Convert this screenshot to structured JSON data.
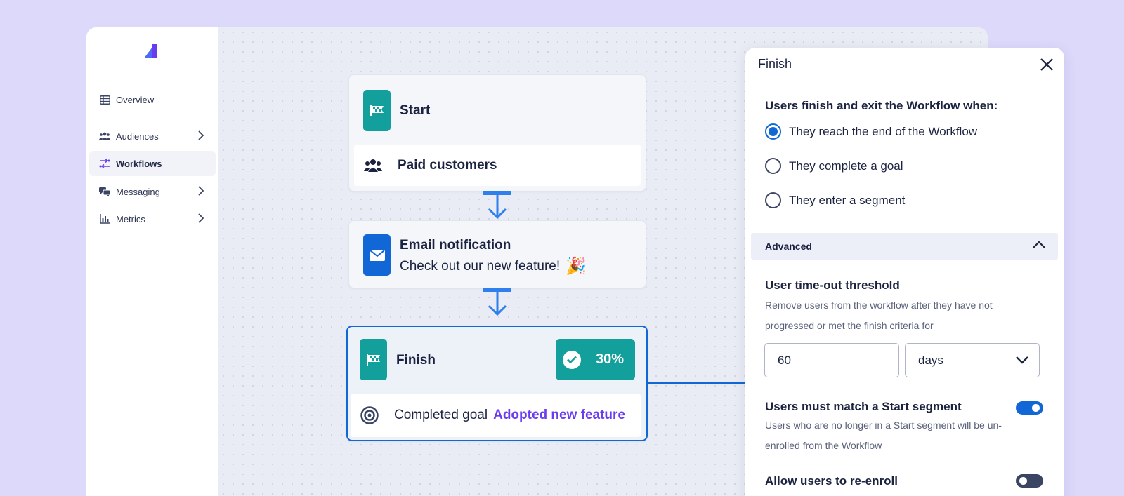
{
  "colors": {
    "accent": "#1167d6",
    "teal": "#139f9b",
    "purple": "#6a3cf0",
    "background": "#dcd9fb"
  },
  "sidebar": {
    "items": [
      {
        "label": "Overview",
        "icon": "table-icon",
        "chevron": false,
        "active": false
      },
      {
        "label": "Audiences",
        "icon": "users-icon",
        "chevron": true,
        "active": false
      },
      {
        "label": "Workflows",
        "icon": "workflow-icon",
        "chevron": false,
        "active": true
      },
      {
        "label": "Messaging",
        "icon": "chat-icon",
        "chevron": true,
        "active": false
      },
      {
        "label": "Metrics",
        "icon": "bar-chart-icon",
        "chevron": true,
        "active": false
      }
    ]
  },
  "workflow": {
    "start": {
      "title": "Start",
      "segment": "Paid customers"
    },
    "email": {
      "title": "Email notification",
      "body": "Check out our new feature!",
      "emoji": "🎉"
    },
    "finish": {
      "title": "Finish",
      "percent": "30%",
      "goal_label": "Completed goal",
      "goal_name": "Adopted new feature"
    }
  },
  "panel": {
    "title": "Finish",
    "exit_heading": "Users finish and exit the Workflow when:",
    "options": [
      {
        "label": "They reach the end of the Workflow",
        "selected": true
      },
      {
        "label": "They complete a goal",
        "selected": false
      },
      {
        "label": "They enter a segment",
        "selected": false
      }
    ],
    "advanced_label": "Advanced",
    "timeout_heading": "User time-out threshold",
    "timeout_help": "Remove users from the workflow after they have not progressed or met the finish criteria for",
    "timeout_value": "60",
    "timeout_unit": "days",
    "match_heading": "Users must match a Start segment",
    "match_on": true,
    "match_help": "Users who are no longer in a Start segment will be un-enrolled from the Workflow",
    "reenroll_heading": "Allow users to re-enroll",
    "reenroll_on": false
  }
}
